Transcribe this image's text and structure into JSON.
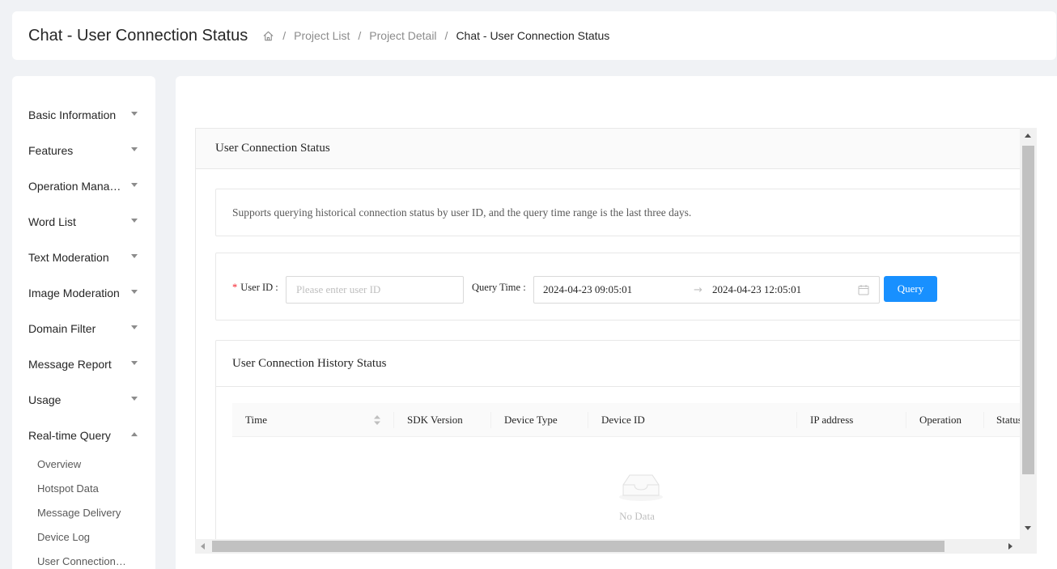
{
  "header": {
    "title": "Chat - User Connection Status",
    "breadcrumb": [
      "Project List",
      "Project Detail",
      "Chat - User Connection Status"
    ]
  },
  "sidebar": {
    "groups": [
      {
        "label": "Basic Information",
        "expanded": false
      },
      {
        "label": "Features",
        "expanded": false
      },
      {
        "label": "Operation Management",
        "expanded": false
      },
      {
        "label": "Word List",
        "expanded": false
      },
      {
        "label": "Text Moderation",
        "expanded": false
      },
      {
        "label": "Image Moderation",
        "expanded": false
      },
      {
        "label": "Domain Filter",
        "expanded": false
      },
      {
        "label": "Message Report",
        "expanded": false
      },
      {
        "label": "Usage",
        "expanded": false
      },
      {
        "label": "Real-time Query",
        "expanded": true
      }
    ],
    "subitems": [
      "Overview",
      "Hotspot Data",
      "Message Delivery",
      "Device Log",
      "User Connection Status"
    ]
  },
  "card": {
    "title": "User Connection Status",
    "notice": "Supports querying historical connection status by user ID, and the query time range is the last three days."
  },
  "query": {
    "user_id_label": "User ID",
    "user_id_placeholder": "Please enter user ID",
    "user_id_value": "",
    "time_label": "Query Time",
    "start_time": "2024-04-23 09:05:01",
    "end_time": "2024-04-23 12:05:01",
    "range_separator": "→",
    "button_label": "Query"
  },
  "history": {
    "title": "User Connection History Status",
    "columns": [
      "Time",
      "SDK Version",
      "Device Type",
      "Device ID",
      "IP address",
      "Operation",
      "Status"
    ],
    "rows": [],
    "empty_text": "No Data"
  },
  "colors": {
    "primary": "#1890ff",
    "required": "#f5222d",
    "page_bg": "#f0f2f5"
  }
}
